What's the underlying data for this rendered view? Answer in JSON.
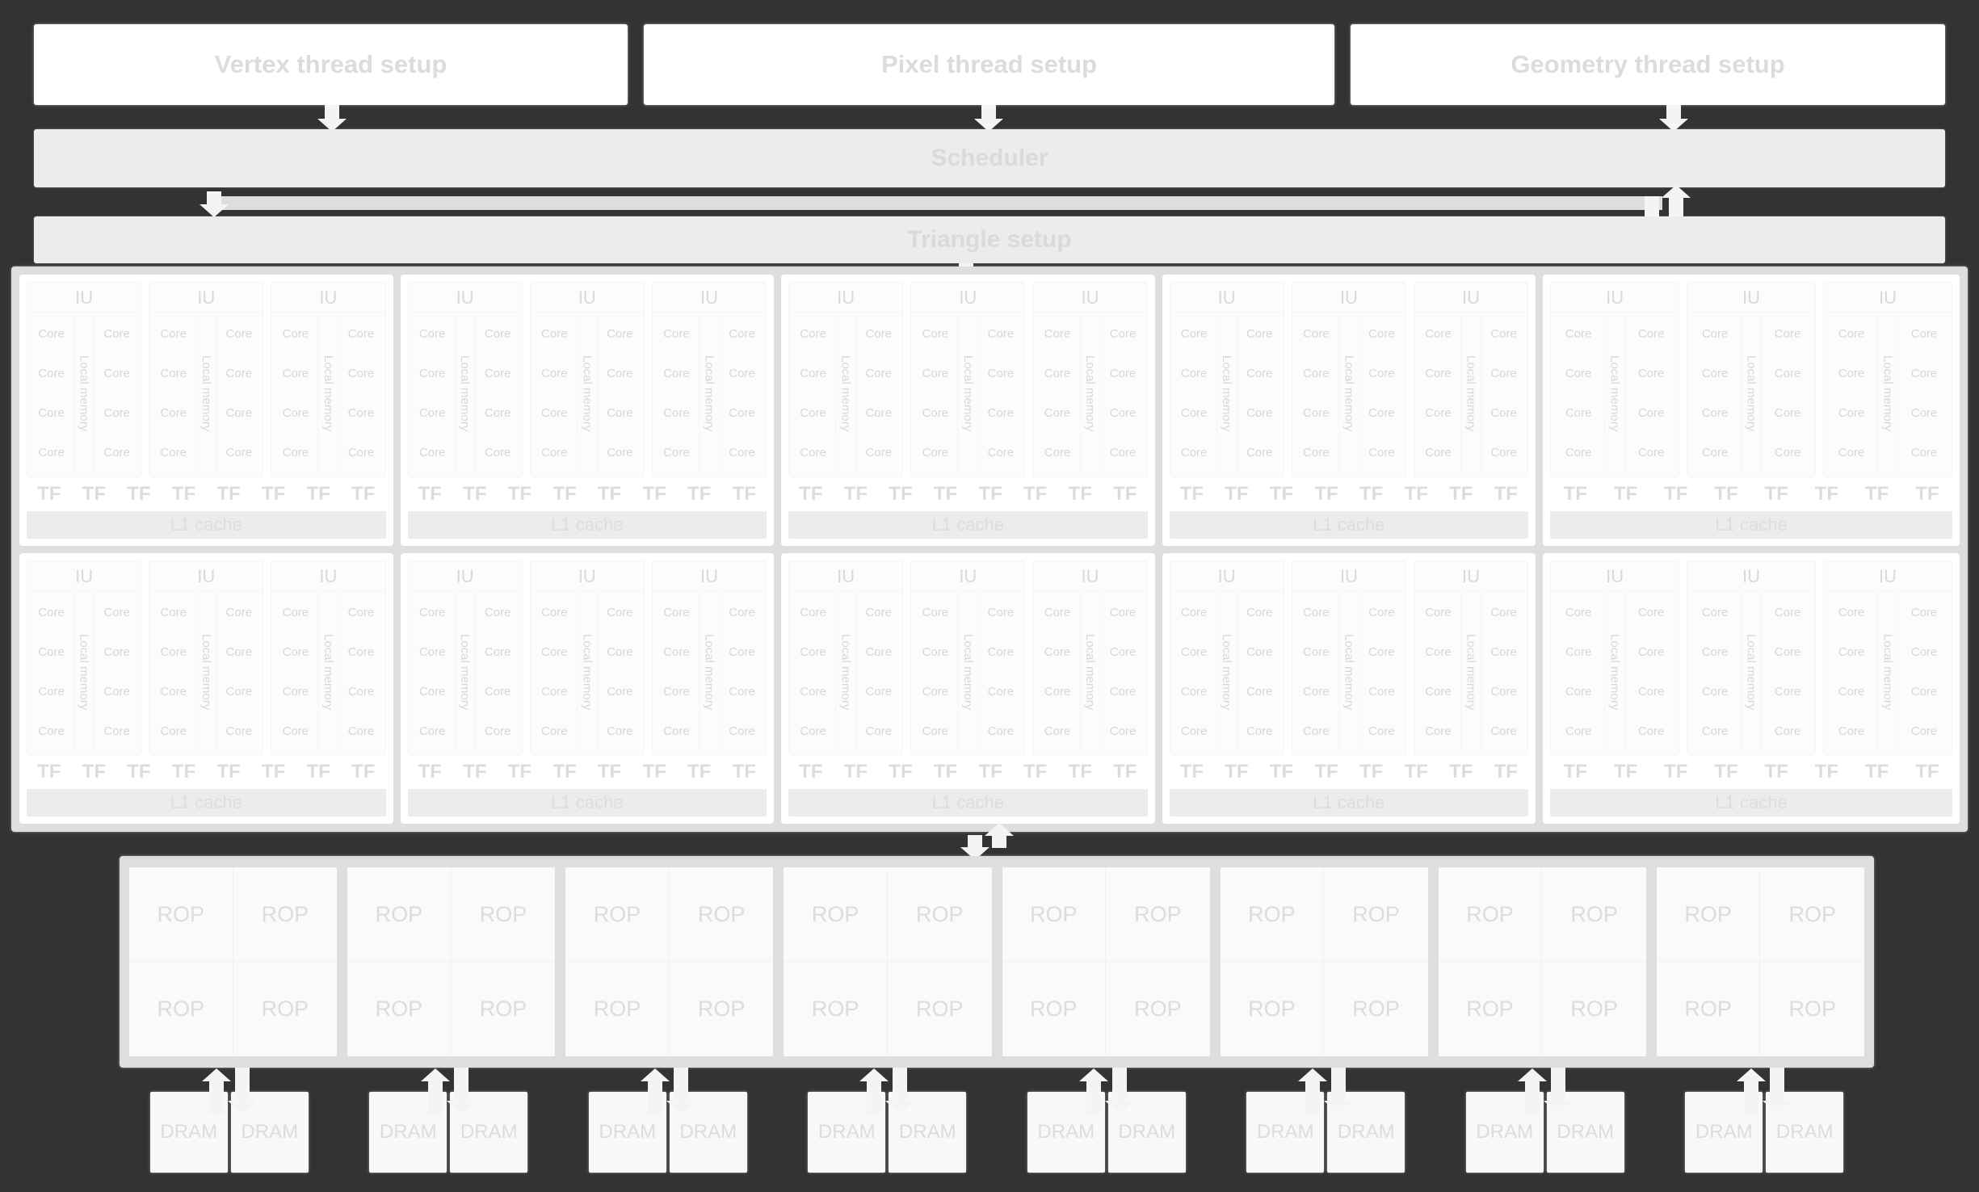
{
  "diagram": {
    "title": "GPU architecture block diagram",
    "colors": {
      "background": "#333333",
      "box_fill": "#ffffff",
      "bar_fill": "#ececec",
      "container_fill": "#dedede",
      "text": "#dcdcdc",
      "arrow": "#f4f4f4"
    }
  },
  "thread_setup": {
    "boxes": [
      {
        "label": "Vertex thread setup"
      },
      {
        "label": "Pixel thread setup"
      },
      {
        "label": "Geometry thread setup"
      }
    ]
  },
  "scheduler": {
    "label": "Scheduler"
  },
  "triangle_setup": {
    "label": "Triangle setup"
  },
  "sm_array": {
    "rows": 2,
    "columns": 5,
    "sm": {
      "iu_count": 3,
      "iu_label": "IU",
      "core_label": "Core",
      "core_rows": 4,
      "core_columns": 2,
      "local_memory_label": "Local memory",
      "tf_label": "TF",
      "tf_count": 8,
      "l1_label": "L1 cache"
    }
  },
  "rop_section": {
    "group_count": 8,
    "cells_per_group": 4,
    "rop_label": "ROP"
  },
  "dram_row": {
    "pair_count": 8,
    "cells_per_pair": 2,
    "dram_label": "DRAM"
  }
}
